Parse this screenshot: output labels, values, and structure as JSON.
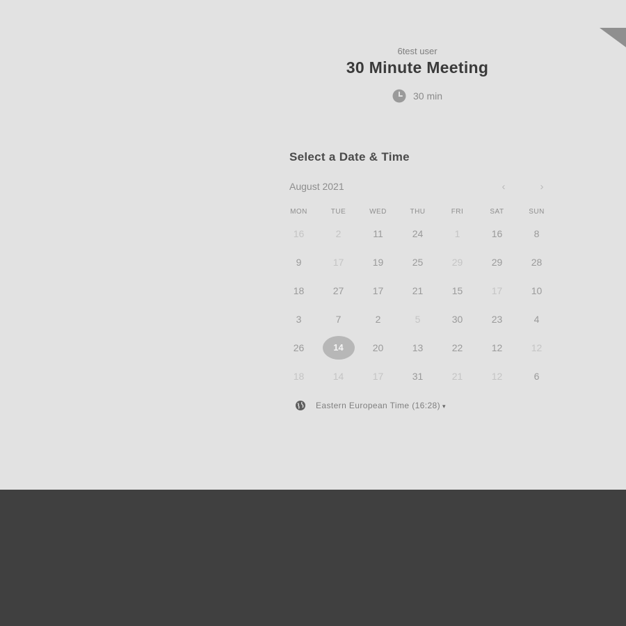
{
  "header": {
    "owner": "6test user",
    "title": "30 Minute Meeting",
    "duration": "30 min"
  },
  "scheduler": {
    "section_title": "Select a Date & Time",
    "month": "August 2021",
    "prev_label": "‹",
    "next_label": "›",
    "weekdays": [
      "MON",
      "TUE",
      "WED",
      "THU",
      "FRI",
      "SAT",
      "SUN"
    ],
    "weeks": [
      [
        "16",
        "2",
        "11",
        "24",
        "1",
        "16",
        "8"
      ],
      [
        "9",
        "17",
        "19",
        "25",
        "29",
        "29",
        "28"
      ],
      [
        "18",
        "27",
        "17",
        "21",
        "15",
        "17",
        "10"
      ],
      [
        "3",
        "7",
        "2",
        "5",
        "30",
        "23",
        "4"
      ],
      [
        "26",
        "14",
        "20",
        "13",
        "22",
        "12",
        "12"
      ],
      [
        "18",
        "14",
        "17",
        "31",
        "21",
        "12",
        "6"
      ]
    ],
    "selected_day": "14",
    "timezone": "Eastern European Time (16:28)",
    "timezone_caret": "▾"
  },
  "colors": {
    "background": "#e2e2e2",
    "footer": "#404040",
    "selected_day_bg": "#b7b7b7"
  },
  "icons": {
    "duration": "clock-icon",
    "timezone": "globe-icon",
    "corner": "corner-badge"
  }
}
